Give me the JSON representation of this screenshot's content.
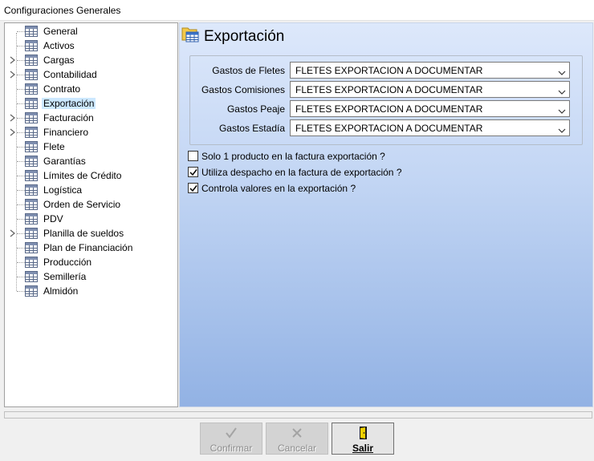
{
  "window": {
    "title": "Configuraciones Generales"
  },
  "tree": {
    "items": [
      {
        "label": "General",
        "expandable": false,
        "selected": false
      },
      {
        "label": "Activos",
        "expandable": false,
        "selected": false
      },
      {
        "label": "Cargas",
        "expandable": true,
        "selected": false
      },
      {
        "label": "Contabilidad",
        "expandable": true,
        "selected": false
      },
      {
        "label": "Contrato",
        "expandable": false,
        "selected": false
      },
      {
        "label": "Exportación",
        "expandable": false,
        "selected": true
      },
      {
        "label": "Facturación",
        "expandable": true,
        "selected": false
      },
      {
        "label": "Financiero",
        "expandable": true,
        "selected": false
      },
      {
        "label": "Flete",
        "expandable": false,
        "selected": false
      },
      {
        "label": "Garantías",
        "expandable": false,
        "selected": false
      },
      {
        "label": "Límites de Crédito",
        "expandable": false,
        "selected": false
      },
      {
        "label": "Logística",
        "expandable": false,
        "selected": false
      },
      {
        "label": "Orden de Servicio",
        "expandable": false,
        "selected": false
      },
      {
        "label": "PDV",
        "expandable": false,
        "selected": false
      },
      {
        "label": "Planilla de sueldos",
        "expandable": true,
        "selected": false
      },
      {
        "label": "Plan de Financiación",
        "expandable": false,
        "selected": false
      },
      {
        "label": "Producción",
        "expandable": false,
        "selected": false
      },
      {
        "label": "Semillería",
        "expandable": false,
        "selected": false
      },
      {
        "label": "Almidón",
        "expandable": false,
        "selected": false
      }
    ]
  },
  "panel": {
    "title": "Exportación",
    "fields": [
      {
        "label": "Gastos de Fletes",
        "value": "FLETES EXPORTACION A DOCUMENTAR"
      },
      {
        "label": "Gastos Comisiones",
        "value": "FLETES EXPORTACION A DOCUMENTAR"
      },
      {
        "label": "Gastos Peaje",
        "value": "FLETES EXPORTACION A DOCUMENTAR"
      },
      {
        "label": "Gastos Estadía",
        "value": "FLETES EXPORTACION A DOCUMENTAR"
      }
    ],
    "checks": [
      {
        "label": "Solo 1 producto en la factura exportación ?",
        "checked": false
      },
      {
        "label": "Utiliza despacho en la factura de exportación ?",
        "checked": true
      },
      {
        "label": "Controla valores en la exportación ?",
        "checked": true
      }
    ]
  },
  "buttons": {
    "confirm": {
      "label": "Confirmar",
      "enabled": false
    },
    "cancel": {
      "label": "Cancelar",
      "enabled": false
    },
    "exit": {
      "label": "Salir",
      "enabled": true
    }
  },
  "colors": {
    "selection": "#cce8ff",
    "panel_gradient_top": "#dde8fb",
    "panel_gradient_bottom": "#92b2e4"
  }
}
